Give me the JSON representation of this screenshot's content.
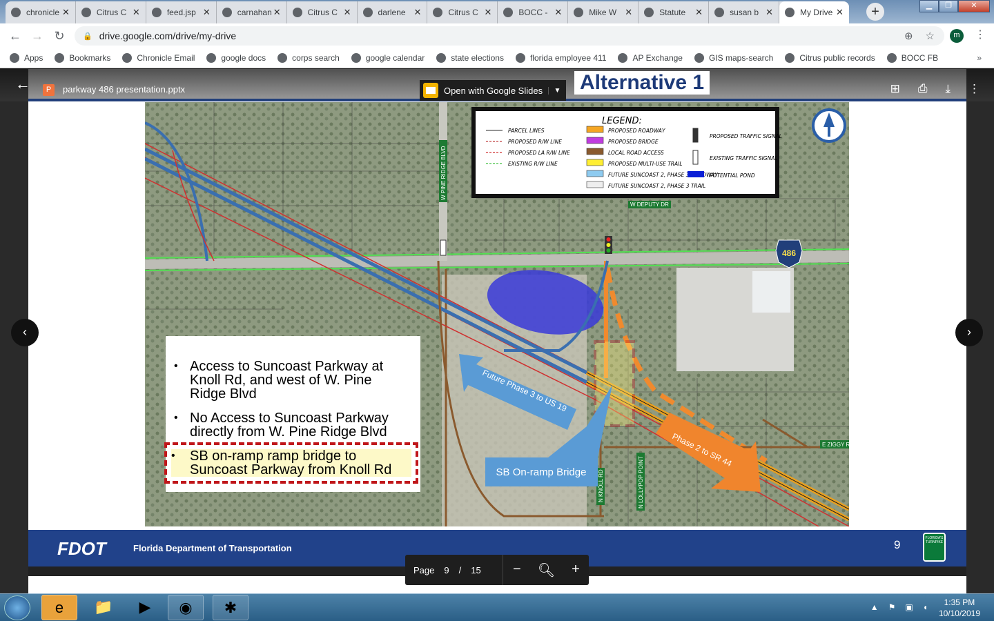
{
  "browser": {
    "tabs": [
      {
        "title": "chronicle",
        "icon": "chronicle-icon"
      },
      {
        "title": "Citrus C",
        "icon": "globe-icon"
      },
      {
        "title": "feed.jsp",
        "icon": "gis-globe-icon"
      },
      {
        "title": "carnahan",
        "icon": "google-docs-icon"
      },
      {
        "title": "Citrus C",
        "icon": "globe-icon"
      },
      {
        "title": "darlene",
        "icon": "google-icon"
      },
      {
        "title": "Citrus C",
        "icon": "globe-icon"
      },
      {
        "title": "BOCC -",
        "icon": "globe-icon"
      },
      {
        "title": "Mike W",
        "icon": "outlook-icon"
      },
      {
        "title": "Statute",
        "icon": "statute-icon"
      },
      {
        "title": "susan b",
        "icon": "google-icon"
      },
      {
        "title": "My Drive",
        "icon": "google-drive-icon",
        "active": true
      }
    ],
    "close_glyph": "✕",
    "url": "drive.google.com/drive/my-drive",
    "profile_initial": "m",
    "bookmarks": [
      {
        "label": "Apps",
        "icon": "apps-grid-icon"
      },
      {
        "label": "Bookmarks",
        "icon": "star-icon"
      },
      {
        "label": "Chronicle Email",
        "icon": "globe-icon"
      },
      {
        "label": "google docs",
        "icon": "google-docs-icon"
      },
      {
        "label": "corps search",
        "icon": "document-icon"
      },
      {
        "label": "google calendar",
        "icon": "google-calendar-icon"
      },
      {
        "label": "state elections",
        "icon": "globe-icon"
      },
      {
        "label": "florida employee 411",
        "icon": "globe-icon"
      },
      {
        "label": "AP Exchange",
        "icon": "ap-icon"
      },
      {
        "label": "GIS maps-search",
        "icon": "gis-globe-icon"
      },
      {
        "label": "Citrus public records",
        "icon": "globe-icon"
      },
      {
        "label": "BOCC FB",
        "icon": "facebook-icon"
      }
    ],
    "bookmarks_more": "»"
  },
  "viewer": {
    "file_name": "parkway 486 presentation.pptx",
    "file_type_letter": "P",
    "open_with": "Open with Google Slides",
    "page_label": "Page",
    "page_current": "9",
    "page_sep": "/",
    "page_total": "15"
  },
  "slide": {
    "title_fragment": "Alternative 1",
    "legend": {
      "title": "LEGEND:",
      "lines": [
        {
          "label": "PARCEL LINES",
          "color": "#555555"
        },
        {
          "label": "PROPOSED R/W LINE",
          "color": "#c04040"
        },
        {
          "label": "PROPOSED LA R/W LINE",
          "color": "#d03030"
        },
        {
          "label": "EXISTING R/W LINE",
          "color": "#40c040"
        }
      ],
      "fills": [
        {
          "label": "PROPOSED ROADWAY",
          "color": "#f5a623"
        },
        {
          "label": "PROPOSED BRIDGE",
          "color": "#c03ce0"
        },
        {
          "label": "LOCAL ROAD ACCESS",
          "color": "#8a5a2e"
        },
        {
          "label": "PROPOSED MULTI-USE TRAIL",
          "color": "#ffee33"
        },
        {
          "label": "FUTURE SUNCOAST 2, PHASE 3 ROADWAY",
          "color": "#8ecbf0"
        },
        {
          "label": "FUTURE SUNCOAST 2, PHASE 3 TRAIL",
          "color": "#eeeeee"
        }
      ],
      "symbols": [
        {
          "label": "PROPOSED TRAFFIC SIGNAL"
        },
        {
          "label": "EXISTING TRAFFIC SIGNAL"
        },
        {
          "label": "POTENTIAL POND",
          "color": "#0a1fd6"
        }
      ]
    },
    "road_labels": {
      "pine_ridge": "W PINE RIDGE BLVD",
      "deputy": "W DEPUTY DR",
      "knoll": "N KNOLL RD",
      "lollypop": "N LOLLYPOP POINT",
      "ziggy": "E ZIGGY R",
      "county_route": "486"
    },
    "arrows": {
      "future": "Future Phase 3 to US 19",
      "sb": "SB On-ramp Bridge",
      "phase2": "Phase 2 to SR 44"
    },
    "bullets": [
      "Access to Suncoast Parkway at Knoll Rd, and west of W. Pine Ridge Blvd",
      "No Access to Suncoast Parkway directly from W. Pine Ridge Blvd",
      "SB on-ramp ramp bridge to Suncoast Parkway from Knoll Rd"
    ],
    "footer": {
      "logo": "FDOT",
      "org": "Florida Department of Transportation",
      "slide_number": "9",
      "turnpike_logo": "FLORIDA'S TURNPIKE"
    }
  },
  "taskbar": {
    "time": "1:35 PM",
    "date": "10/10/2019",
    "apps": [
      "internet-explorer-icon",
      "file-explorer-icon",
      "media-player-icon",
      "chrome-icon",
      "slack-icon"
    ]
  }
}
